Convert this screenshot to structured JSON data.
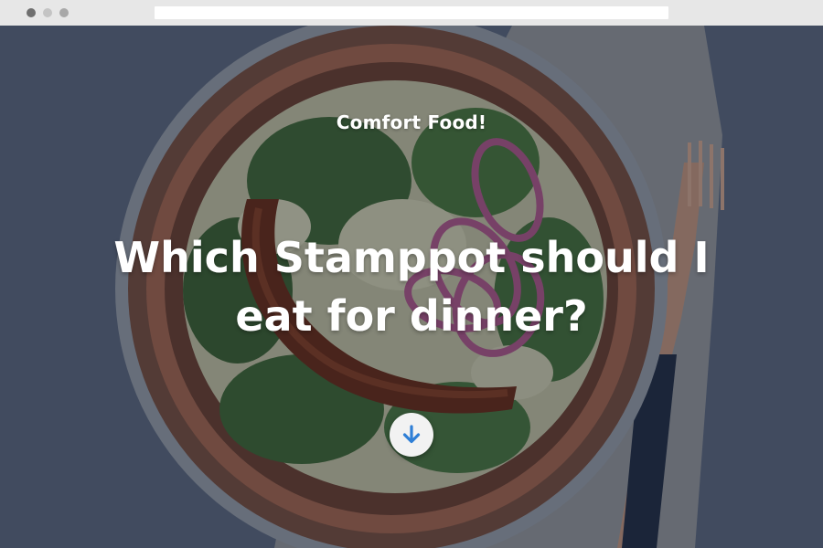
{
  "hero": {
    "eyebrow": "Comfort Food!",
    "headline": "Which Stamppot should I eat for dinner?",
    "scroll_icon": "arrow-down-icon"
  },
  "colors": {
    "overlay": "#141a28",
    "button_bg": "#f2f2f2",
    "arrow": "#2f7fd6",
    "text": "#ffffff"
  }
}
